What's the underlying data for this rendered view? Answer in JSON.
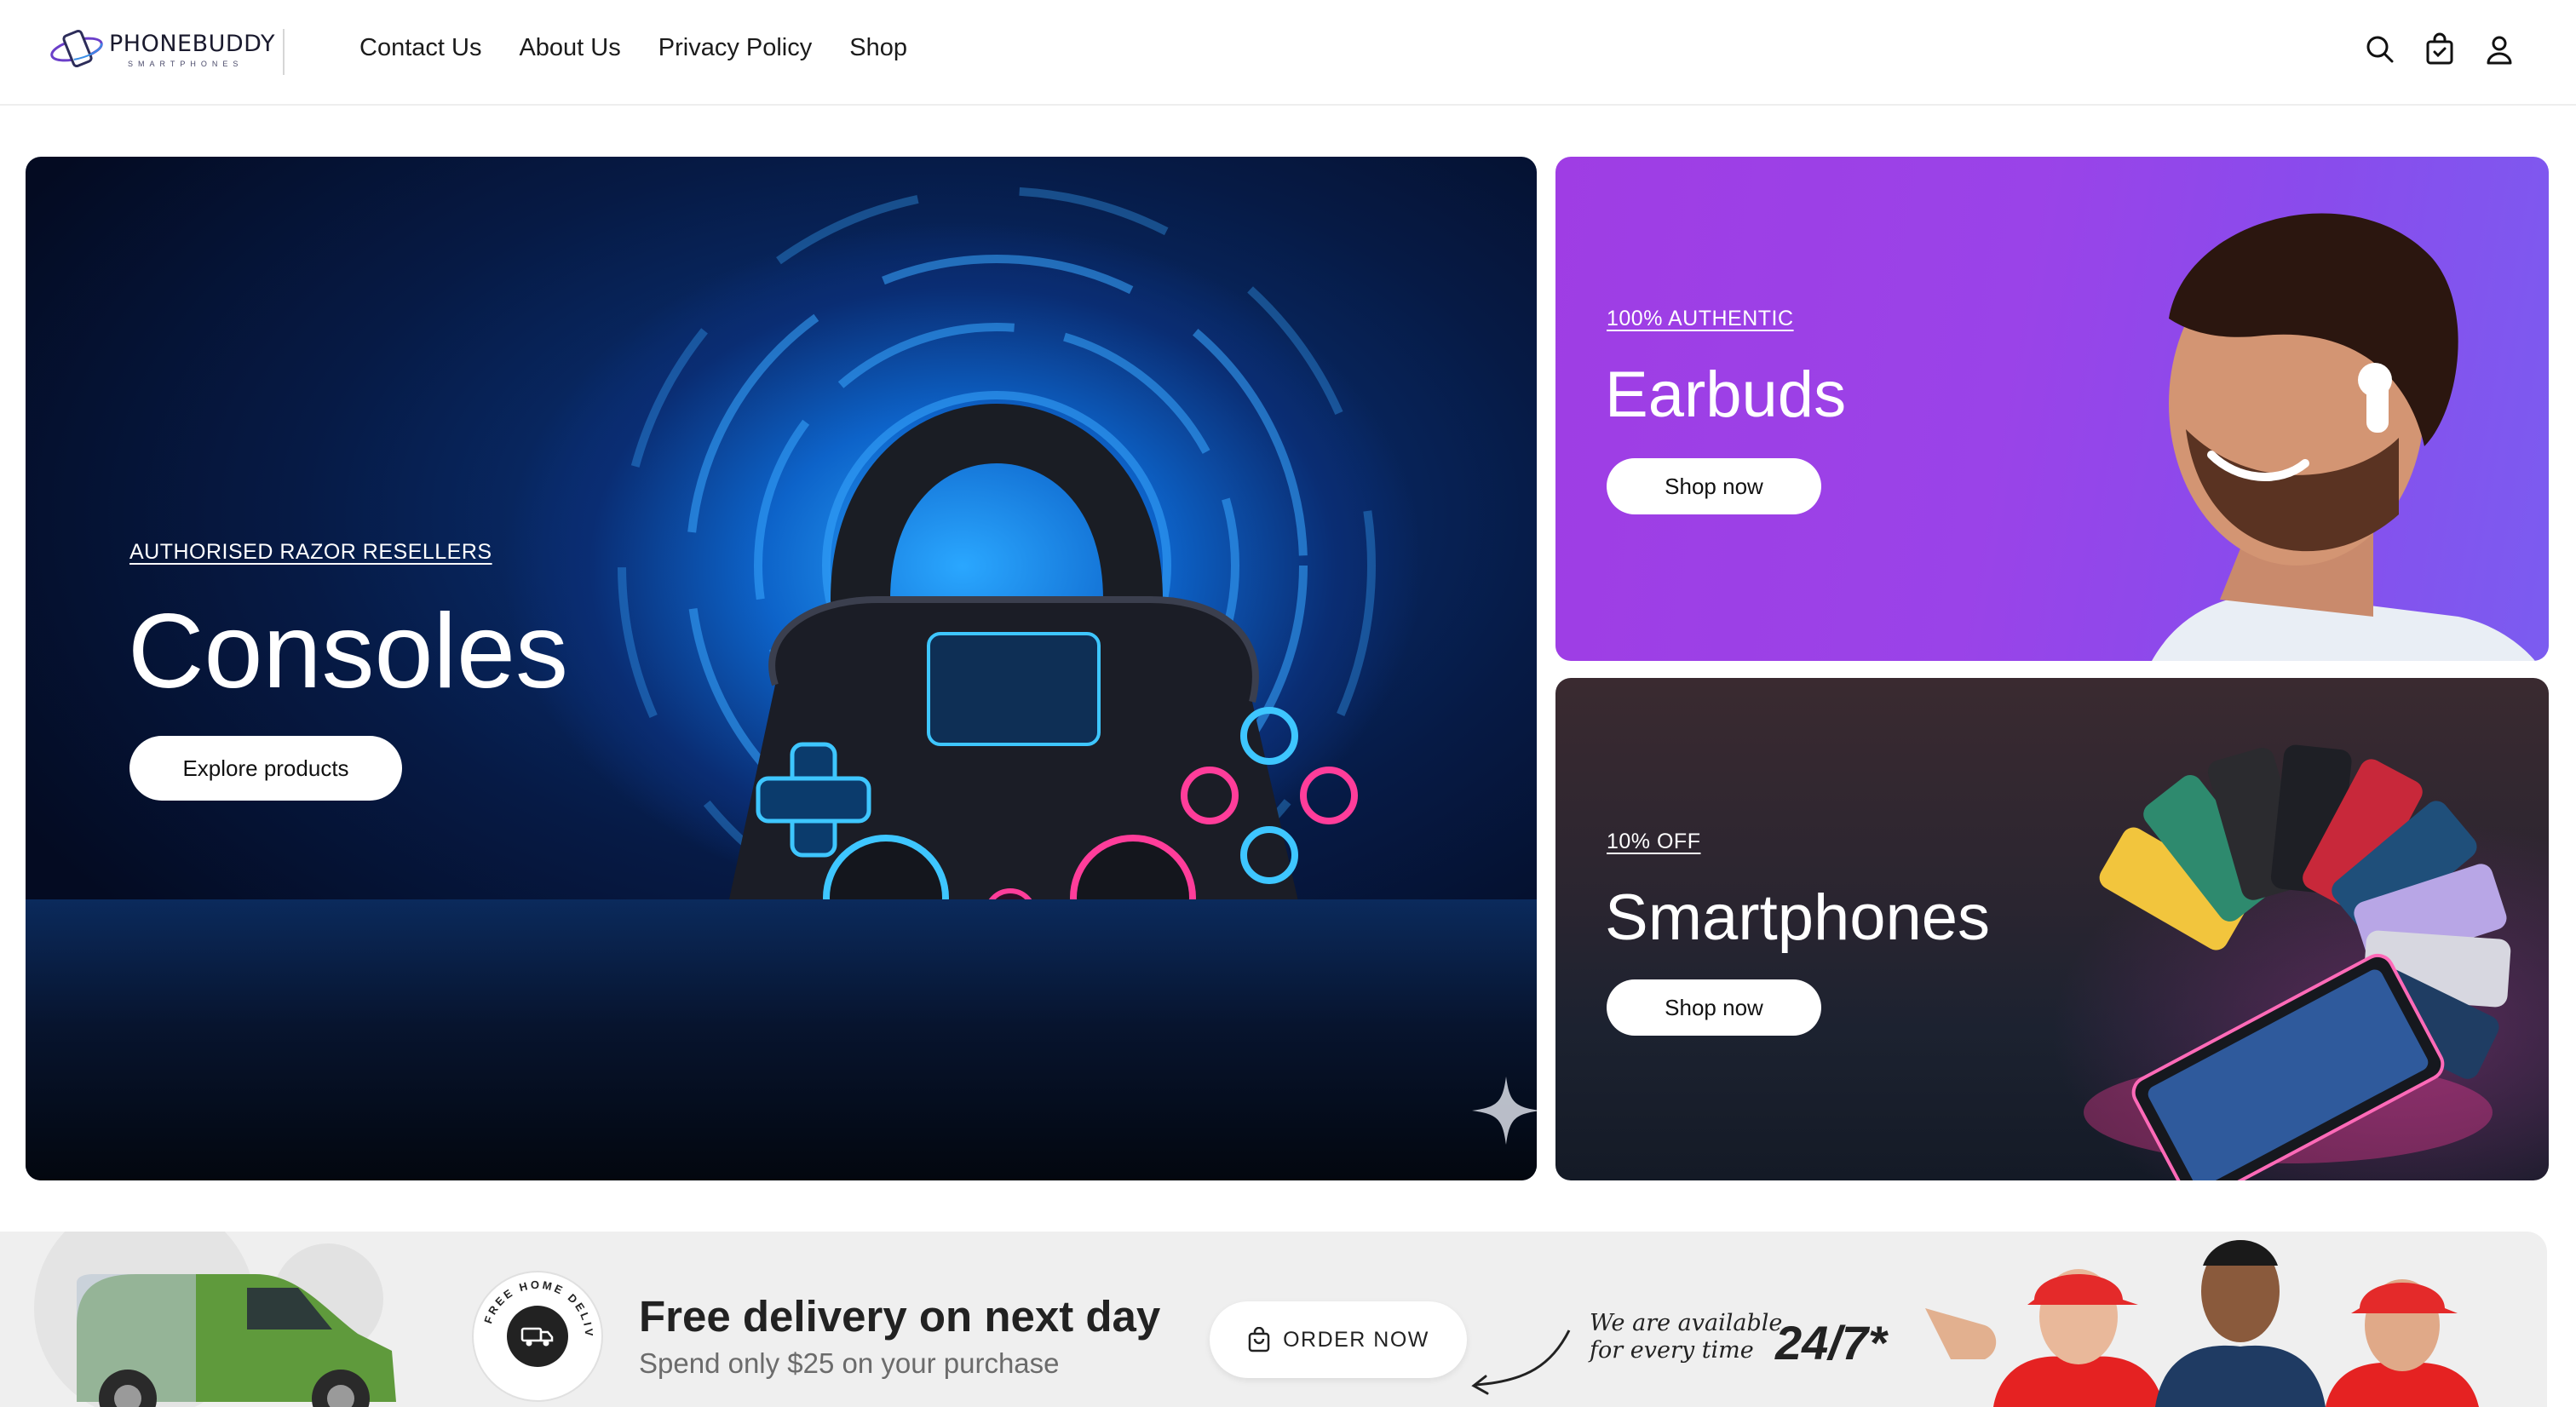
{
  "brand": {
    "name": "PHONEBUDDY",
    "tagline": "SMARTPHONES"
  },
  "nav": {
    "items": [
      "Contact Us",
      "About Us",
      "Privacy Policy",
      "Shop"
    ]
  },
  "header_icons": [
    "search-icon",
    "cart-icon",
    "account-icon"
  ],
  "hero": {
    "consoles": {
      "eyebrow": "AUTHORISED RAZOR RESELLERS",
      "title": "Consoles",
      "button": "Explore products"
    },
    "earbuds": {
      "eyebrow": "100% AUTHENTIC",
      "title": "Earbuds",
      "button": "Shop now"
    },
    "smartphones": {
      "eyebrow": "10% OFF",
      "title": "Smartphones",
      "button": "Shop now"
    }
  },
  "promo": {
    "badge_text": "FREE HOME DELIVERY",
    "title": "Free delivery on next day",
    "subtitle": "Spend only $25 on your purchase",
    "order_button": "ORDER NOW",
    "availability_line1": "We are available",
    "availability_line2": "for every time",
    "availability_hours": "24/7*"
  },
  "colors": {
    "earbuds_bg": "#9a43e8",
    "consoles_glow": "#2aa7ff",
    "accent_pink": "#ff3d9a"
  }
}
